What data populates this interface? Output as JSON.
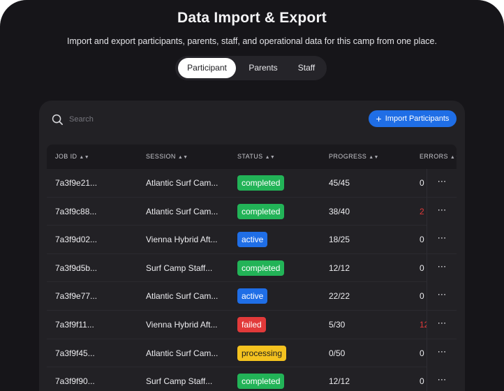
{
  "page": {
    "title": "Data Import & Export",
    "subtitle": "Import and export participants, parents, staff, and operational data for this camp from one place."
  },
  "tabs": [
    {
      "label": "Participant",
      "active": true
    },
    {
      "label": "Parents",
      "active": false
    },
    {
      "label": "Staff",
      "active": false
    }
  ],
  "toolbar": {
    "search_placeholder": "Search",
    "import_label": "Import Participants",
    "search_icon": "search-icon",
    "plus_icon": "plus-icon"
  },
  "table": {
    "columns": [
      "JOB ID",
      "SESSION",
      "STATUS",
      "PROGRESS",
      "ERRORS"
    ],
    "rows": [
      {
        "job_id": "7a3f9e21...",
        "session": "Atlantic Surf Cam...",
        "status": "completed",
        "progress": "45/45",
        "errors": "0",
        "menu": "⋯"
      },
      {
        "job_id": "7a3f9c88...",
        "session": "Atlantic Surf Cam...",
        "status": "completed",
        "progress": "38/40",
        "errors": "2",
        "menu": "⋯"
      },
      {
        "job_id": "7a3f9d02...",
        "session": "Vienna Hybrid Aft...",
        "status": "active",
        "progress": "18/25",
        "errors": "0",
        "menu": "⋯"
      },
      {
        "job_id": "7a3f9d5b...",
        "session": "Surf Camp Staff...",
        "status": "completed",
        "progress": "12/12",
        "errors": "0",
        "menu": "⋯"
      },
      {
        "job_id": "7a3f9e77...",
        "session": "Atlantic Surf Cam...",
        "status": "active",
        "progress": "22/22",
        "errors": "0",
        "menu": "⋯"
      },
      {
        "job_id": "7a3f9f11...",
        "session": "Vienna Hybrid Aft...",
        "status": "failed",
        "progress": "5/30",
        "errors": "12",
        "menu": "⋯"
      },
      {
        "job_id": "7a3f9f45...",
        "session": "Atlantic Surf Cam...",
        "status": "processing",
        "progress": "0/50",
        "errors": "0",
        "menu": "⋯"
      },
      {
        "job_id": "7a3f9f90...",
        "session": "Surf Camp Staff...",
        "status": "completed",
        "progress": "12/12",
        "errors": "0",
        "menu": "⋯"
      }
    ]
  },
  "colors": {
    "background": "#161519",
    "card": "#222125",
    "accent": "#1f6ee6",
    "completed": "#22b357",
    "active": "#1f6ee6",
    "failed": "#e23a3a",
    "processing": "#f4c21f",
    "error_text": "#e23a3a"
  }
}
